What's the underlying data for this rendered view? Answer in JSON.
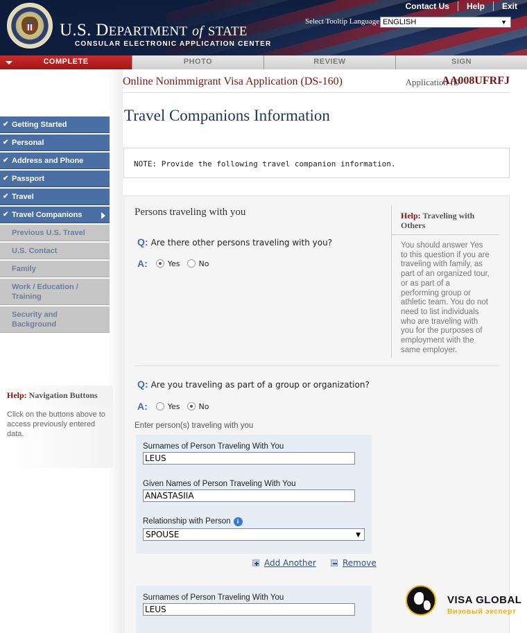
{
  "header": {
    "title_initial_u": "U",
    "title_initial_s": "S",
    "title_initial_d": "D",
    "title_epartment": "EPARTMENT",
    "title_of": "of",
    "title_state": "STATE",
    "subtitle": "CONSULAR ELECTRONIC APPLICATION CENTER",
    "links": [
      "Contact Us",
      "Help",
      "Exit"
    ],
    "language_label": "Select Tooltip Language",
    "language_value": "ENGLISH"
  },
  "tabs": [
    {
      "label": "COMPLETE",
      "active": true
    },
    {
      "label": "PHOTO",
      "active": false
    },
    {
      "label": "REVIEW",
      "active": false
    },
    {
      "label": "SIGN",
      "active": false
    }
  ],
  "application": {
    "title": "Online Nonimmigrant Visa Application (DS-160)",
    "id_label": "Application ID",
    "id_value": "AA008UFRFJ"
  },
  "sidebar": {
    "items": [
      {
        "label": "Getting Started",
        "state": "done"
      },
      {
        "label": "Personal",
        "state": "done"
      },
      {
        "label": "Address and Phone",
        "state": "done"
      },
      {
        "label": "Passport",
        "state": "done"
      },
      {
        "label": "Travel",
        "state": "done"
      },
      {
        "label": "Travel Companions",
        "state": "current"
      },
      {
        "label": "Previous U.S. Travel",
        "state": "future"
      },
      {
        "label": "U.S. Contact",
        "state": "future"
      },
      {
        "label": "Family",
        "state": "future"
      },
      {
        "label": "Work / Education / Training",
        "state": "future"
      },
      {
        "label": "Security and Background",
        "state": "future"
      }
    ],
    "help_title_prefix": "Help:",
    "help_title": "Navigation Buttons",
    "help_body": "Click on the buttons above to access previously entered data."
  },
  "main": {
    "page_title": "Travel Companions Information",
    "note": "NOTE: Provide the following travel companion information.",
    "section_title": "Persons traveling with you",
    "q_marker": "Q:",
    "a_marker": "A:",
    "question1": "Are there other persons traveling with you?",
    "question1_answer": "Yes",
    "question2": "Are you traveling as part of a group or organization?",
    "question2_answer": "No",
    "yes_label": "Yes",
    "no_label": "No",
    "help_title_prefix": "Help:",
    "help_title": "Traveling with Others",
    "help_body": "You should answer Yes to this question if you are traveling with family, as part of an organized tour, or as part of a performing group or athletic team. You do not need to list individuals who are traveling with you for the purposes of employment with the same employer.",
    "enter_label": "Enter person(s) traveling with you",
    "surname_label": "Surnames of Person Traveling With You",
    "given_label": "Given Names of Person Traveling With You",
    "relationship_label": "Relationship with Person",
    "companions": [
      {
        "surname": "LEUS",
        "given": "ANASTASIIA",
        "relationship": "SPOUSE"
      },
      {
        "surname": "LEUS"
      }
    ],
    "add_another": "Add Another",
    "remove": "Remove"
  },
  "watermark": {
    "name": "VISA GLOBAL",
    "tagline": "Визовый эксперт"
  }
}
